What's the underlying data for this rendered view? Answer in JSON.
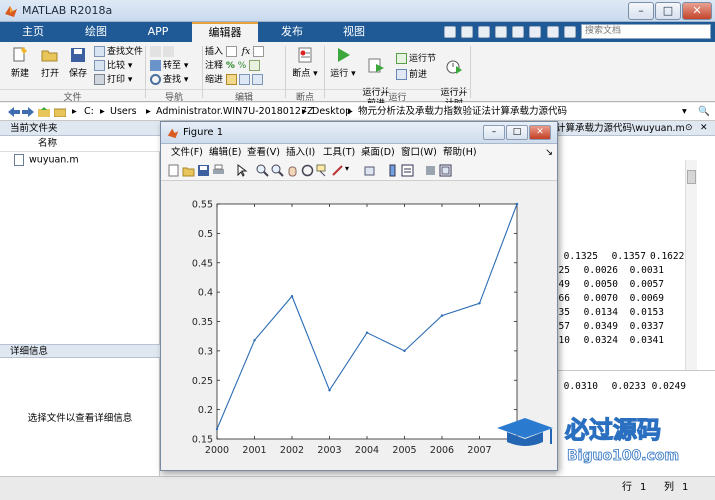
{
  "window": {
    "title": "MATLAB R2018a"
  },
  "tabs": [
    {
      "label": "主页",
      "active": false
    },
    {
      "label": "绘图",
      "active": false
    },
    {
      "label": "APP",
      "active": false
    },
    {
      "label": "编辑器",
      "active": true
    },
    {
      "label": "发布",
      "active": false
    },
    {
      "label": "视图",
      "active": false
    }
  ],
  "search": {
    "placeholder": "搜索文档"
  },
  "ribbon": {
    "file": {
      "new": "新建",
      "open": "打开",
      "save": "保存",
      "find_files": "查找文件",
      "compare": "比较",
      "print": "打印",
      "group": "文件"
    },
    "nav": {
      "goto": "转至",
      "find": "查找",
      "group": "导航"
    },
    "edit": {
      "insert": "插入",
      "comment": "注释",
      "indent": "缩进",
      "group": "编辑"
    },
    "breakpoints": {
      "label": "断点",
      "group": "断点"
    },
    "run": {
      "run": "运行",
      "run_advance": "运行并\n前进",
      "run_section": "运行节",
      "advance": "前进",
      "run_time": "运行并\n计时",
      "group": "运行"
    }
  },
  "address": {
    "drive": "C:",
    "parts": [
      "Users",
      "Administrator.WIN7U-20180127Z",
      "Desktop",
      "物元分析法及承载力指数验证法计算承载力源代码"
    ]
  },
  "current_folder": {
    "header": "当前文件夹",
    "name_col": "名称",
    "files": [
      "wuyuan.m"
    ]
  },
  "details": {
    "header": "详细信息",
    "message": "选择文件以查看详细信息"
  },
  "editor": {
    "tab_title": "计算承载力源代码\\wuyuan.m",
    "row_top": [
      "0.1325",
      "0.1357",
      "0.1622"
    ],
    "rows": [
      [
        "25",
        "0.0026",
        "0.0031"
      ],
      [
        "49",
        "0.0050",
        "0.0057"
      ],
      [
        "66",
        "0.0070",
        "0.0069"
      ],
      [
        "35",
        "0.0134",
        "0.0153"
      ],
      [
        "57",
        "0.0349",
        "0.0337"
      ],
      [
        "10",
        "0.0324",
        "0.0341"
      ]
    ],
    "cmd_row": [
      "0.0310",
      "0.0233",
      "0.0249"
    ]
  },
  "status": {
    "row_label": "行",
    "row_val": "1",
    "col_label": "列",
    "col_val": "1"
  },
  "figure": {
    "title": "Figure 1",
    "menu": [
      "文件(F)",
      "编辑(E)",
      "查看(V)",
      "插入(I)",
      "工具(T)",
      "桌面(D)",
      "窗口(W)",
      "帮助(H)"
    ]
  },
  "chart_data": {
    "type": "line",
    "x": [
      2000,
      2001,
      2002,
      2003,
      2004,
      2005,
      2006,
      2007,
      2008
    ],
    "y": [
      0.167,
      0.318,
      0.393,
      0.233,
      0.331,
      0.3,
      0.36,
      0.381,
      0.55
    ],
    "xticks": [
      "2000",
      "2001",
      "2002",
      "2003",
      "2004",
      "2005",
      "2006",
      "2007"
    ],
    "yticks": [
      "0.15",
      "0.2",
      "0.25",
      "0.3",
      "0.35",
      "0.4",
      "0.45",
      "0.5",
      "0.55"
    ],
    "xlim": [
      2000,
      2008
    ],
    "ylim": [
      0.15,
      0.55
    ],
    "line_color": "#2d6db5",
    "grid": false
  },
  "watermark": {
    "brand": "必过源码",
    "domain": "Biguo100.com"
  }
}
